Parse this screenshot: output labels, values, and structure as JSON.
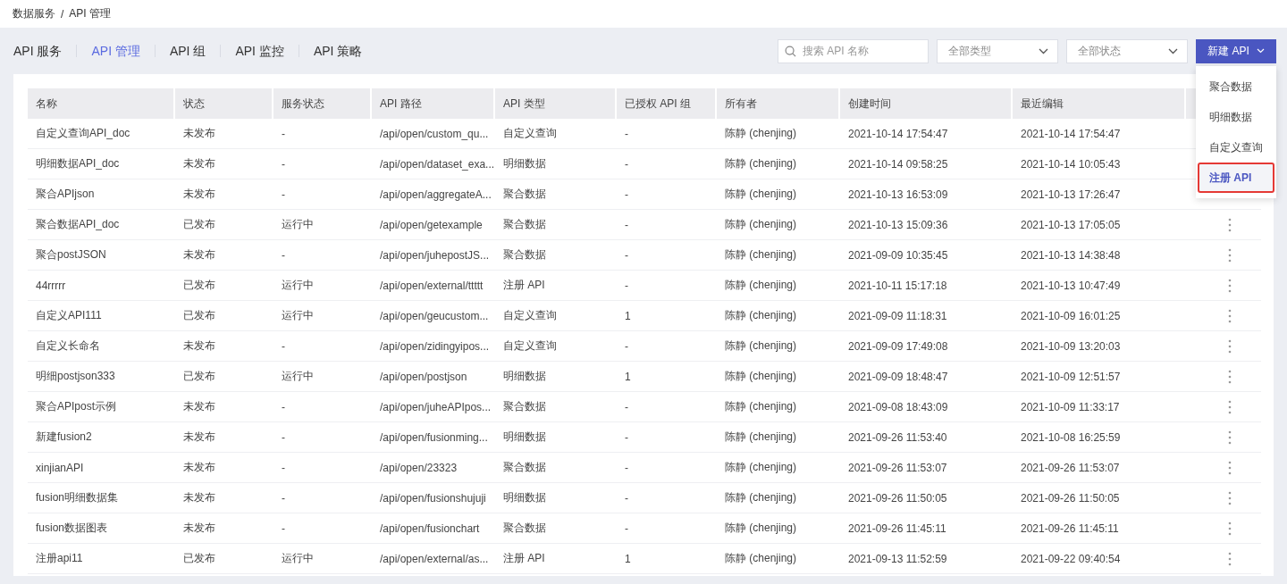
{
  "breadcrumb": [
    "数据服务",
    "API 管理"
  ],
  "breadcrumb_separator": "/",
  "tabs": [
    {
      "label": "API 服务",
      "selected": false
    },
    {
      "label": "API 管理",
      "selected": true
    },
    {
      "label": "API 组",
      "selected": false
    },
    {
      "label": "API 监控",
      "selected": false
    },
    {
      "label": "API 策略",
      "selected": false
    }
  ],
  "search": {
    "placeholder": "搜索 API 名称"
  },
  "filters": [
    {
      "placeholder": "全部类型"
    },
    {
      "placeholder": "全部状态"
    }
  ],
  "new_button": {
    "label": "新建 API",
    "menu": [
      {
        "label": "聚合数据",
        "selected": false
      },
      {
        "label": "明细数据",
        "selected": false
      },
      {
        "label": "自定义查询",
        "selected": false
      },
      {
        "label": "注册 API",
        "selected": true
      }
    ]
  },
  "table": {
    "columns": [
      "名称",
      "状态",
      "服务状态",
      "API 路径",
      "API 类型",
      "已授权 API 组",
      "所有者",
      "创建时间",
      "最近编辑"
    ],
    "rows": [
      {
        "cells": [
          "自定义查询API_doc",
          "未发布",
          "-",
          "/api/open/custom_qu...",
          "自定义查询",
          "-",
          "陈静 (chenjing)",
          "2021-10-14 17:54:47",
          "2021-10-14 17:54:47"
        ],
        "more_visible": false
      },
      {
        "cells": [
          "明细数据API_doc",
          "未发布",
          "-",
          "/api/open/dataset_exa...",
          "明细数据",
          "-",
          "陈静 (chenjing)",
          "2021-10-14 09:58:25",
          "2021-10-14 10:05:43"
        ],
        "more_visible": false
      },
      {
        "cells": [
          "聚合APIjson",
          "未发布",
          "-",
          "/api/open/aggregateA...",
          "聚合数据",
          "-",
          "陈静 (chenjing)",
          "2021-10-13 16:53:09",
          "2021-10-13 17:26:47"
        ],
        "more_visible": false
      },
      {
        "cells": [
          "聚合数据API_doc",
          "已发布",
          "运行中",
          "/api/open/getexample",
          "聚合数据",
          "-",
          "陈静 (chenjing)",
          "2021-10-13 15:09:36",
          "2021-10-13 17:05:05"
        ],
        "more_visible": true
      },
      {
        "cells": [
          "聚合postJSON",
          "未发布",
          "-",
          "/api/open/juhepostJS...",
          "聚合数据",
          "-",
          "陈静 (chenjing)",
          "2021-09-09 10:35:45",
          "2021-10-13 14:38:48"
        ],
        "more_visible": true
      },
      {
        "cells": [
          "44rrrrr",
          "已发布",
          "运行中",
          "/api/open/external/ttttt",
          "注册 API",
          "-",
          "陈静 (chenjing)",
          "2021-10-11 15:17:18",
          "2021-10-13 10:47:49"
        ],
        "more_visible": true
      },
      {
        "cells": [
          "自定义API111",
          "已发布",
          "运行中",
          "/api/open/geucustom...",
          "自定义查询",
          "1",
          "陈静 (chenjing)",
          "2021-09-09 11:18:31",
          "2021-10-09 16:01:25"
        ],
        "more_visible": true
      },
      {
        "cells": [
          "自定义长命名",
          "未发布",
          "-",
          "/api/open/zidingyipos...",
          "自定义查询",
          "-",
          "陈静 (chenjing)",
          "2021-09-09 17:49:08",
          "2021-10-09 13:20:03"
        ],
        "more_visible": true
      },
      {
        "cells": [
          "明细postjson333",
          "已发布",
          "运行中",
          "/api/open/postjson",
          "明细数据",
          "1",
          "陈静 (chenjing)",
          "2021-09-09 18:48:47",
          "2021-10-09 12:51:57"
        ],
        "more_visible": true
      },
      {
        "cells": [
          "聚合APIpost示例",
          "未发布",
          "-",
          "/api/open/juheAPIpos...",
          "聚合数据",
          "-",
          "陈静 (chenjing)",
          "2021-09-08 18:43:09",
          "2021-10-09 11:33:17"
        ],
        "more_visible": true
      },
      {
        "cells": [
          "新建fusion2",
          "未发布",
          "-",
          "/api/open/fusionming...",
          "明细数据",
          "-",
          "陈静 (chenjing)",
          "2021-09-26 11:53:40",
          "2021-10-08 16:25:59"
        ],
        "more_visible": true
      },
      {
        "cells": [
          "xinjianAPI",
          "未发布",
          "-",
          "/api/open/23323",
          "聚合数据",
          "-",
          "陈静 (chenjing)",
          "2021-09-26 11:53:07",
          "2021-09-26 11:53:07"
        ],
        "more_visible": true
      },
      {
        "cells": [
          "fusion明细数据集",
          "未发布",
          "-",
          "/api/open/fusionshujuji",
          "明细数据",
          "-",
          "陈静 (chenjing)",
          "2021-09-26 11:50:05",
          "2021-09-26 11:50:05"
        ],
        "more_visible": true
      },
      {
        "cells": [
          "fusion数据图表",
          "未发布",
          "-",
          "/api/open/fusionchart",
          "聚合数据",
          "-",
          "陈静 (chenjing)",
          "2021-09-26 11:45:11",
          "2021-09-26 11:45:11"
        ],
        "more_visible": true
      },
      {
        "cells": [
          "注册api11",
          "已发布",
          "运行中",
          "/api/open/external/as...",
          "注册 API",
          "1",
          "陈静 (chenjing)",
          "2021-09-13 11:52:59",
          "2021-09-22 09:40:54"
        ],
        "more_visible": true
      }
    ]
  }
}
